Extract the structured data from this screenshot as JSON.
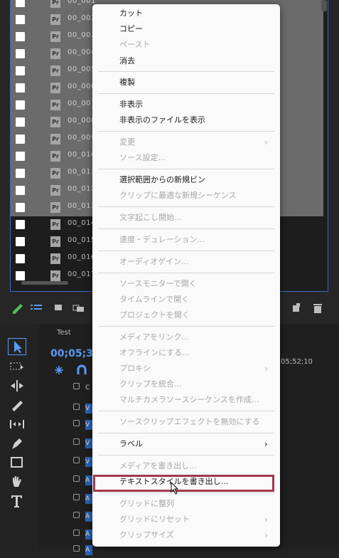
{
  "project_items": [
    {
      "name": "00_001",
      "selected": true
    },
    {
      "name": "00_002",
      "selected": true
    },
    {
      "name": "00_003",
      "selected": true
    },
    {
      "name": "00_004",
      "selected": true
    },
    {
      "name": "00_005",
      "selected": true
    },
    {
      "name": "00_006",
      "selected": true
    },
    {
      "name": "00_007",
      "selected": true
    },
    {
      "name": "00_008",
      "selected": true
    },
    {
      "name": "00_009",
      "selected": true
    },
    {
      "name": "00_010",
      "selected": true
    },
    {
      "name": "00_011",
      "selected": true
    },
    {
      "name": "00_012",
      "selected": true
    },
    {
      "name": "00_013",
      "selected": true
    },
    {
      "name": "00_014",
      "selected": false
    },
    {
      "name": "00_015",
      "selected": false
    },
    {
      "name": "00_016",
      "selected": false
    },
    {
      "name": "00_017",
      "selected": false
    }
  ],
  "pr_badge": "Pr",
  "timeline": {
    "sequence_tab": "Test",
    "timecode": "00;05;39",
    "ruler_time": "05;52;10",
    "track_tags": [
      "C",
      "V",
      "V",
      "V",
      "V",
      "A",
      "A",
      "A",
      "A",
      "A"
    ]
  },
  "menu": {
    "cut": "カット",
    "copy": "コピー",
    "paste": "ペースト",
    "clear": "消去",
    "duplicate": "複製",
    "hide": "非表示",
    "show_hidden": "非表示のファイルを表示",
    "modify": "変更",
    "source_settings": "ソース設定...",
    "new_bin_from_selection": "選択範囲からの新規ビン",
    "new_sequence_from_clip": "クリップに最適な新規シーケンス",
    "start_transcription": "文字起こし開始...",
    "speed_duration": "速度・デュレーション...",
    "audio_gain": "オーディオゲイン...",
    "open_in_source_monitor": "ソースモニターで開く",
    "open_in_timeline": "タイムラインで開く",
    "open_project": "プロジェクトを開く",
    "link_media": "メディアをリンク...",
    "make_offline": "オフラインにする...",
    "proxy": "プロキシ",
    "merge_clips": "クリップを統合...",
    "multicam_sequence": "マルチカメラソースシーケンスを作成...",
    "disable_source_effects": "ソースクリップエフェクトを無効にする",
    "label": "ラベル",
    "export_media": "メディアを書き出し...",
    "export_text_styles": "テキストスタイルを書き出し...",
    "align_to_grid": "グリッドに整列",
    "reset_to_grid": "グリッドにリセット",
    "clip_size": "クリップサイズ"
  },
  "colors": {
    "highlight_box": "#a3364f",
    "timecode": "#5a9bf5",
    "panel_focus_border": "#3a6bc4"
  }
}
